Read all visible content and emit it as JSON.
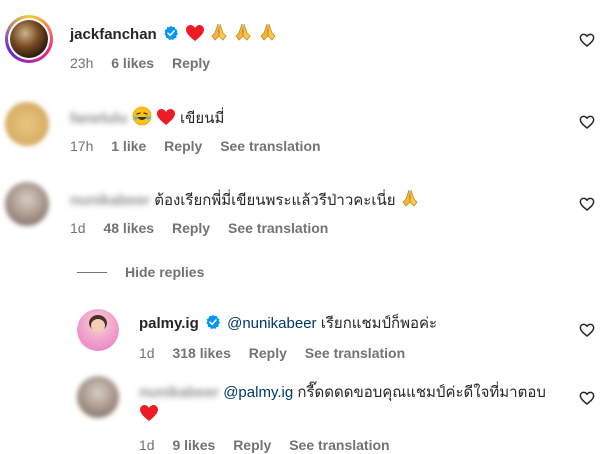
{
  "comments": [
    {
      "username": "jackfanchan",
      "text": "",
      "time": "23h",
      "likes": "6 likes",
      "reply": "Reply",
      "see_translation": ""
    },
    {
      "username": "fanelulu",
      "text": "เขียนมี่",
      "time": "17h",
      "likes": "1 like",
      "reply": "Reply",
      "see_translation": "See translation"
    },
    {
      "username": "nunikabeer",
      "text": "ต้องเรียกพี่มี่เขียนพระแล้วรีป่าวคะเนี่ย",
      "time": "1d",
      "likes": "48 likes",
      "reply": "Reply",
      "see_translation": "See translation"
    }
  ],
  "hide_replies": "Hide replies",
  "replies": [
    {
      "username": "palmy.ig",
      "mention": "@nunikabeer",
      "text": "เรียกแชมป์ก็พอค่ะ",
      "time": "1d",
      "likes": "318 likes",
      "reply": "Reply",
      "see_translation": "See translation"
    },
    {
      "username": "nunikabeer",
      "mention": "@palmy.ig",
      "text": "กรี๊ดดดดขอบคุณแชมป์ค่ะดีใจที่มาตอบ",
      "time": "1d",
      "likes": "9 likes",
      "reply": "Reply",
      "see_translation": "See translation"
    }
  ],
  "colors": {
    "heart": "#ed1c24",
    "verified": "#0095f6",
    "mention": "#00376b",
    "meta": "#737373"
  }
}
